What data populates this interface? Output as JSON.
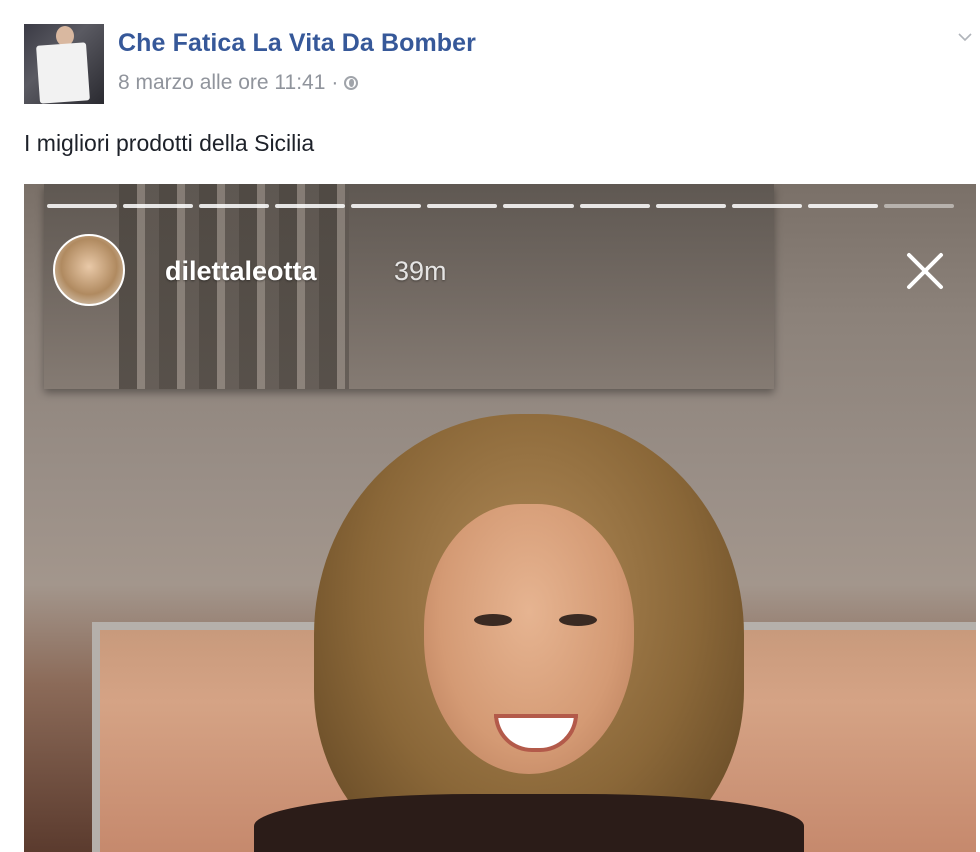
{
  "post": {
    "page_name": "Che Fatica La Vita Da Bomber",
    "timestamp": "8 marzo alle ore 11:41",
    "separator": "·",
    "privacy_icon": "globe-icon",
    "text": "I migliori prodotti della Sicilia"
  },
  "story": {
    "username": "dilettaleotta",
    "time": "39m",
    "segments_total": 12,
    "segments_viewed": 11,
    "close_icon": "close-icon"
  },
  "colors": {
    "link": "#365899",
    "meta": "#90949c",
    "text": "#1d2129"
  }
}
